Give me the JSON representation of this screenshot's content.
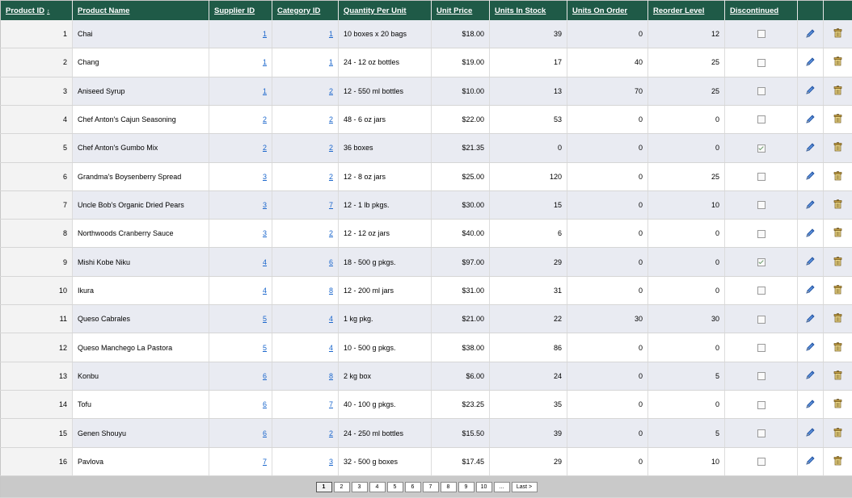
{
  "columns": {
    "product_id": "Product ID",
    "sort_indicator": "↕",
    "product_name": "Product Name",
    "supplier_id": "Supplier ID",
    "category_id": "Category ID",
    "quantity_per_unit": "Quantity Per Unit",
    "unit_price": "Unit Price",
    "units_in_stock": "Units In Stock",
    "units_on_order": "Units On Order",
    "reorder_level": "Reorder Level",
    "discontinued": "Discontinued"
  },
  "rows": [
    {
      "id": "1",
      "name": "Chai",
      "supplier": "1",
      "category": "1",
      "qty": "10 boxes x 20 bags",
      "price": "$18.00",
      "stock": "39",
      "order": "0",
      "reorder": "12",
      "discontinued": false
    },
    {
      "id": "2",
      "name": "Chang",
      "supplier": "1",
      "category": "1",
      "qty": "24 - 12 oz bottles",
      "price": "$19.00",
      "stock": "17",
      "order": "40",
      "reorder": "25",
      "discontinued": false
    },
    {
      "id": "3",
      "name": "Aniseed Syrup",
      "supplier": "1",
      "category": "2",
      "qty": "12 - 550 ml bottles",
      "price": "$10.00",
      "stock": "13",
      "order": "70",
      "reorder": "25",
      "discontinued": false
    },
    {
      "id": "4",
      "name": "Chef Anton's Cajun Seasoning",
      "supplier": "2",
      "category": "2",
      "qty": "48 - 6 oz jars",
      "price": "$22.00",
      "stock": "53",
      "order": "0",
      "reorder": "0",
      "discontinued": false
    },
    {
      "id": "5",
      "name": "Chef Anton's Gumbo Mix",
      "supplier": "2",
      "category": "2",
      "qty": "36 boxes",
      "price": "$21.35",
      "stock": "0",
      "order": "0",
      "reorder": "0",
      "discontinued": true
    },
    {
      "id": "6",
      "name": "Grandma's Boysenberry Spread",
      "supplier": "3",
      "category": "2",
      "qty": "12 - 8 oz jars",
      "price": "$25.00",
      "stock": "120",
      "order": "0",
      "reorder": "25",
      "discontinued": false
    },
    {
      "id": "7",
      "name": "Uncle Bob's Organic Dried Pears",
      "supplier": "3",
      "category": "7",
      "qty": "12 - 1 lb pkgs.",
      "price": "$30.00",
      "stock": "15",
      "order": "0",
      "reorder": "10",
      "discontinued": false
    },
    {
      "id": "8",
      "name": "Northwoods Cranberry Sauce",
      "supplier": "3",
      "category": "2",
      "qty": "12 - 12 oz jars",
      "price": "$40.00",
      "stock": "6",
      "order": "0",
      "reorder": "0",
      "discontinued": false
    },
    {
      "id": "9",
      "name": "Mishi Kobe Niku",
      "supplier": "4",
      "category": "6",
      "qty": "18 - 500 g pkgs.",
      "price": "$97.00",
      "stock": "29",
      "order": "0",
      "reorder": "0",
      "discontinued": true
    },
    {
      "id": "10",
      "name": "Ikura",
      "supplier": "4",
      "category": "8",
      "qty": "12 - 200 ml jars",
      "price": "$31.00",
      "stock": "31",
      "order": "0",
      "reorder": "0",
      "discontinued": false
    },
    {
      "id": "11",
      "name": "Queso Cabrales",
      "supplier": "5",
      "category": "4",
      "qty": "1 kg pkg.",
      "price": "$21.00",
      "stock": "22",
      "order": "30",
      "reorder": "30",
      "discontinued": false
    },
    {
      "id": "12",
      "name": "Queso Manchego La Pastora",
      "supplier": "5",
      "category": "4",
      "qty": "10 - 500 g pkgs.",
      "price": "$38.00",
      "stock": "86",
      "order": "0",
      "reorder": "0",
      "discontinued": false
    },
    {
      "id": "13",
      "name": "Konbu",
      "supplier": "6",
      "category": "8",
      "qty": "2 kg box",
      "price": "$6.00",
      "stock": "24",
      "order": "0",
      "reorder": "5",
      "discontinued": false
    },
    {
      "id": "14",
      "name": "Tofu",
      "supplier": "6",
      "category": "7",
      "qty": "40 - 100 g pkgs.",
      "price": "$23.25",
      "stock": "35",
      "order": "0",
      "reorder": "0",
      "discontinued": false
    },
    {
      "id": "15",
      "name": "Genen Shouyu",
      "supplier": "6",
      "category": "2",
      "qty": "24 - 250 ml bottles",
      "price": "$15.50",
      "stock": "39",
      "order": "0",
      "reorder": "5",
      "discontinued": false
    },
    {
      "id": "16",
      "name": "Pavlova",
      "supplier": "7",
      "category": "3",
      "qty": "32 - 500 g boxes",
      "price": "$17.45",
      "stock": "29",
      "order": "0",
      "reorder": "10",
      "discontinued": false
    }
  ],
  "icons": {
    "edit": "pencil-icon",
    "delete": "trash-icon"
  },
  "colors": {
    "header_bg": "#1f5a47",
    "alt_row_bg": "#e9ebf2",
    "link": "#1a66cc",
    "pager_bg": "#c9c9c9"
  },
  "pager": {
    "current_page": 1,
    "pages": [
      "1",
      "2",
      "3",
      "4",
      "5",
      "6",
      "7",
      "8",
      "9",
      "10"
    ],
    "ellipsis": "...",
    "last_label": "Last >"
  }
}
